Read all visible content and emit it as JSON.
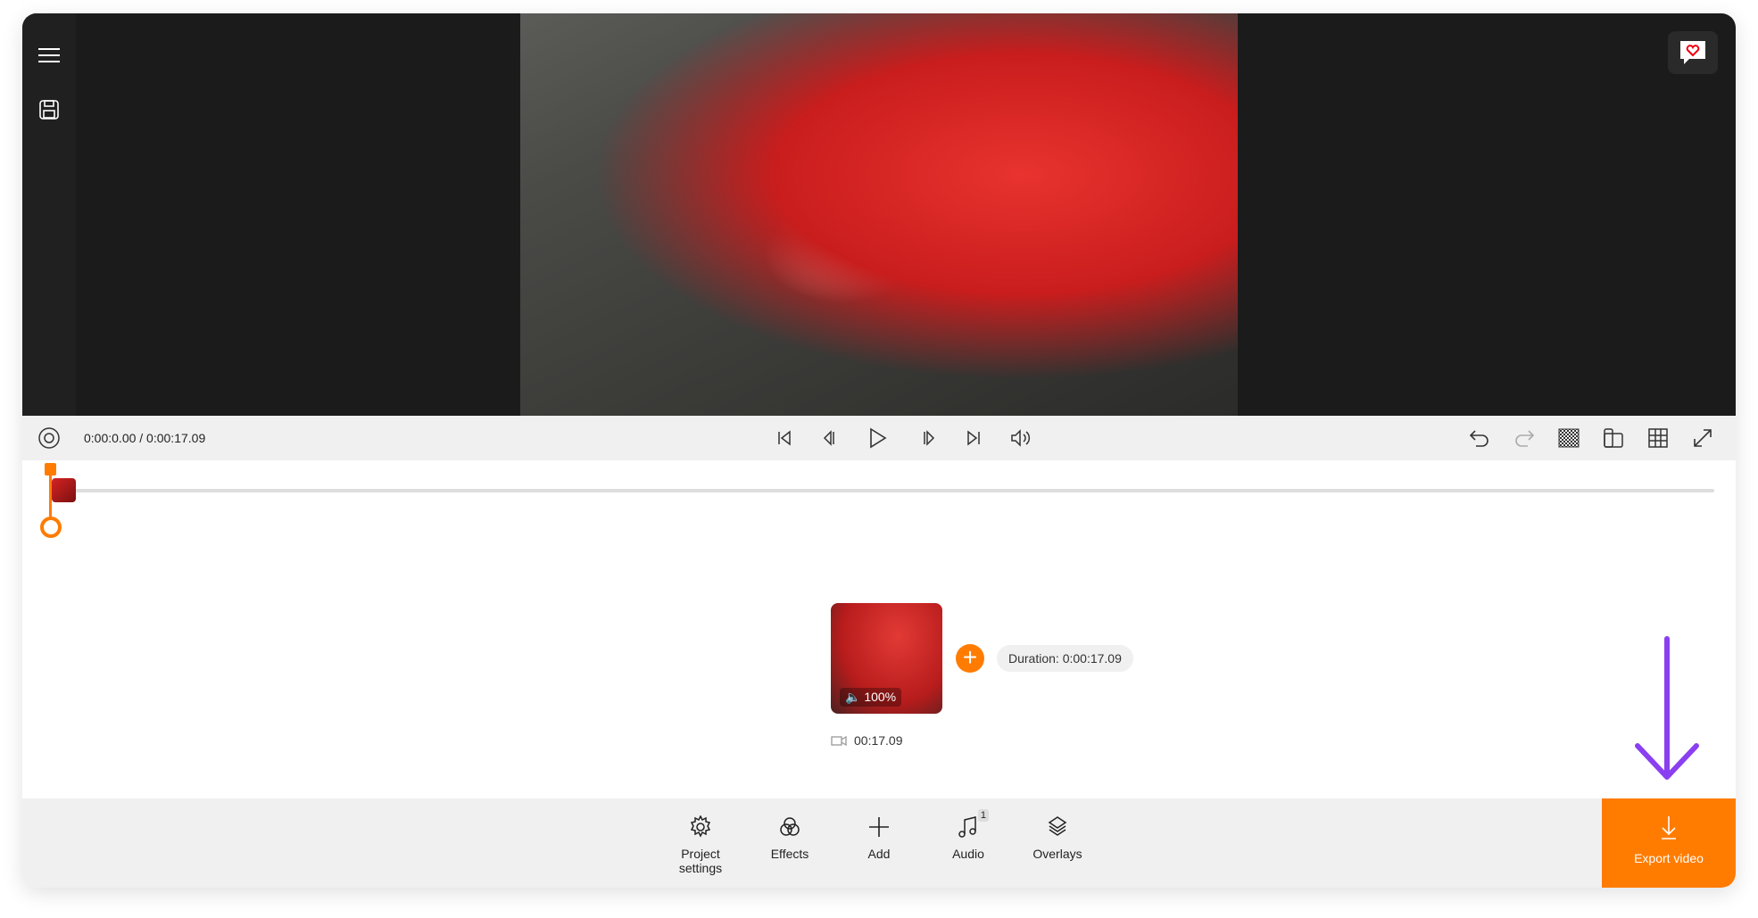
{
  "sidebar": {
    "items": [
      {
        "icon": "hamburger-menu-icon"
      },
      {
        "icon": "save-icon"
      }
    ]
  },
  "player": {
    "time_display": "0:00:0.00 / 0:00:17.09"
  },
  "clip": {
    "volume": "100%",
    "length": "00:17.09",
    "duration_label": "Duration: 0:00:17.09"
  },
  "toolbar": {
    "items": [
      {
        "label": "Project settings",
        "icon": "gear-icon"
      },
      {
        "label": "Effects",
        "icon": "effects-icon"
      },
      {
        "label": "Add",
        "icon": "plus-icon"
      },
      {
        "label": "Audio",
        "icon": "music-note-icon",
        "badge": "1"
      },
      {
        "label": "Overlays",
        "icon": "layers-icon"
      }
    ],
    "export_label": "Export video"
  },
  "colors": {
    "accent": "#ff7c00",
    "annotation_arrow": "#8a3ff0",
    "video_bg": "#1b1b1b"
  }
}
